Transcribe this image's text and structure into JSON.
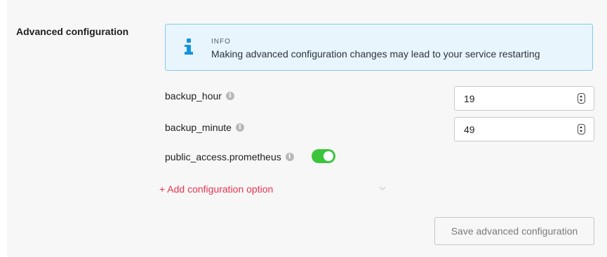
{
  "section": {
    "title": "Advanced configuration"
  },
  "info": {
    "label": "INFO",
    "message": "Making advanced configuration changes may lead to your service restarting",
    "icon": "info-icon",
    "accent": "#1296db"
  },
  "fields": [
    {
      "label": "backup_hour",
      "value": "19",
      "icon": "help-icon"
    },
    {
      "label": "backup_minute",
      "value": "49",
      "icon": "help-icon"
    },
    {
      "label": "public_access.prometheus",
      "enabled": true,
      "icon": "help-icon",
      "toggle_color": "#3cc53c"
    }
  ],
  "add_option": {
    "label": "+ Add configuration option",
    "color": "#e8344e",
    "icon": "chevron-down-icon"
  },
  "save": {
    "label": "Save advanced configuration"
  }
}
